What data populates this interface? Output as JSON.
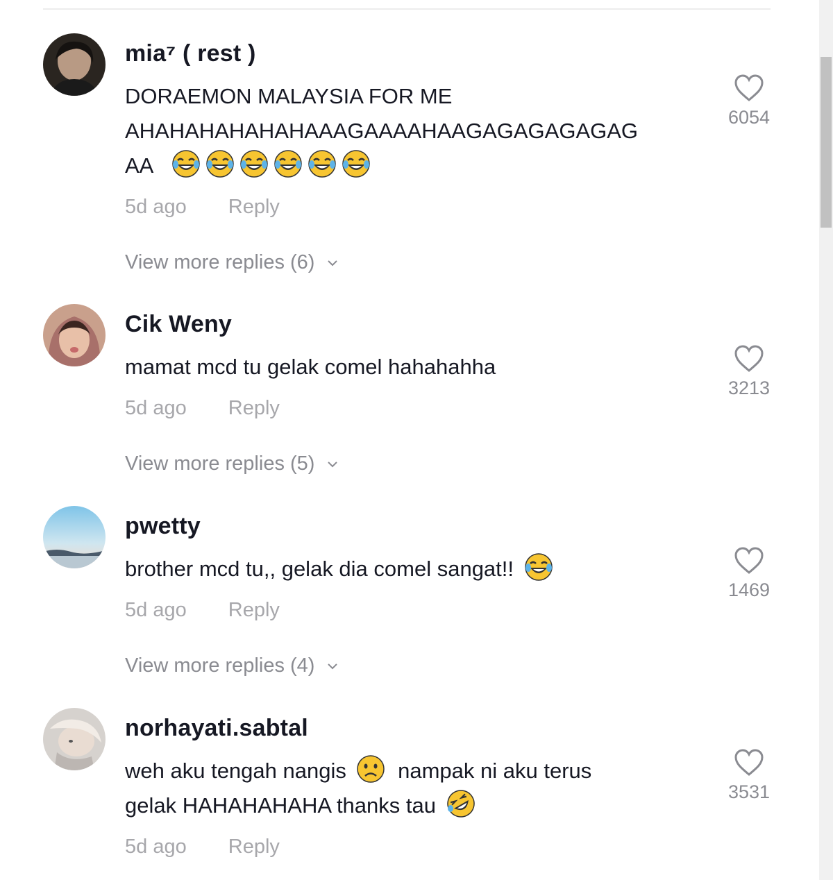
{
  "comments": [
    {
      "username": "mia⁷ ( rest )",
      "text_line1": "DORAEMON MALAYSIA FOR ME",
      "text_line2": "AHAHAHAHAHAHAAAGAAAAHAAGAGAGAGAGAG",
      "text_line3": "AA",
      "time": "5d ago",
      "reply_label": "Reply",
      "likes": "6054",
      "more_replies": "View more replies (6)",
      "emoji_trailing": [
        "tears-of-joy-emoji",
        "tears-of-joy-emoji",
        "tears-of-joy-emoji",
        "tears-of-joy-emoji",
        "tears-of-joy-emoji",
        "tears-of-joy-emoji"
      ]
    },
    {
      "username": "Cik Weny",
      "text_line1": "mamat mcd tu gelak comel hahahahha",
      "time": "5d ago",
      "reply_label": "Reply",
      "likes": "3213",
      "more_replies": "View more replies (5)"
    },
    {
      "username": "pwetty",
      "text_line1": "brother mcd tu,, gelak dia comel sangat!!",
      "time": "5d ago",
      "reply_label": "Reply",
      "likes": "1469",
      "more_replies": "View more replies (4)",
      "emoji_trailing": [
        "tears-of-joy-emoji"
      ]
    },
    {
      "username": "norhayati.sabtal",
      "text_line1_a": "weh aku tengah nangis",
      "text_line1_b": "nampak ni aku terus",
      "text_line2": "gelak HAHAHAHAHA thanks tau",
      "time": "5d ago",
      "reply_label": "Reply",
      "likes": "3531",
      "emoji_inline": [
        "frowning-face-emoji",
        "rolling-on-floor-laughing-emoji"
      ]
    }
  ],
  "colors": {
    "primary_text": "#161823",
    "muted_text": "#a7a7ab",
    "secondary_text": "#8a8b91",
    "divider": "#ececec",
    "scrollbar_thumb": "#c1c1c1",
    "emoji_yellow": "#f7c531"
  }
}
